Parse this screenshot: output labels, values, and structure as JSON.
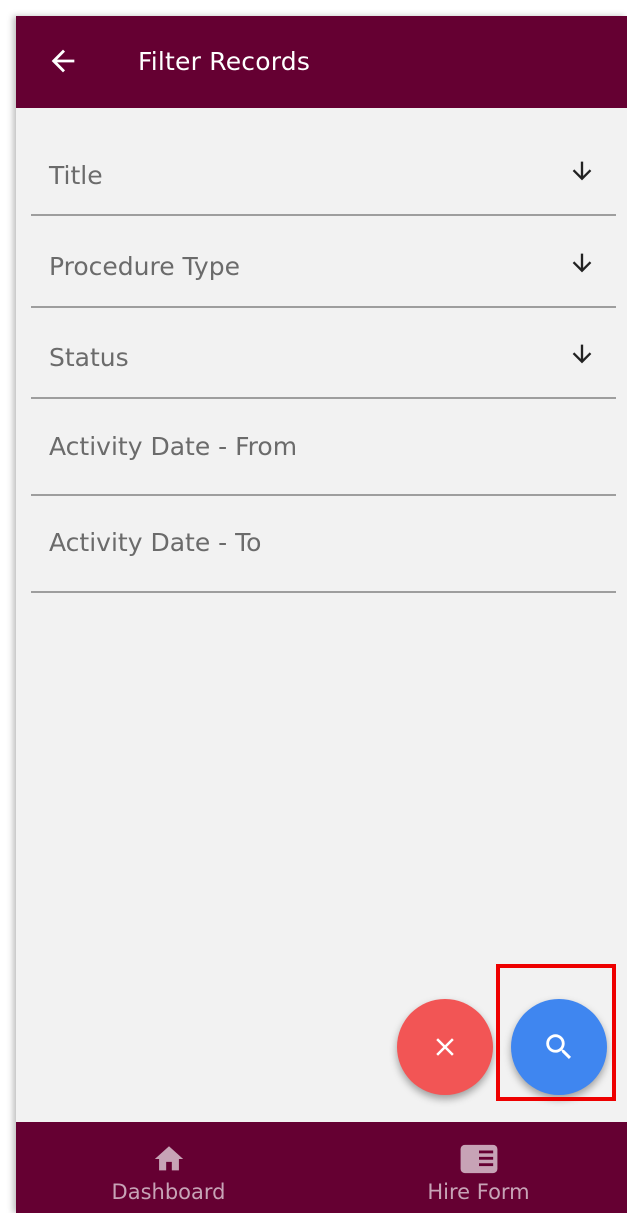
{
  "header": {
    "title": "Filter Records",
    "back_icon": "arrow-left-icon"
  },
  "filters": [
    {
      "label": "Title",
      "has_dropdown": true
    },
    {
      "label": "Procedure Type",
      "has_dropdown": true
    },
    {
      "label": "Status",
      "has_dropdown": true
    },
    {
      "label": "Activity Date - From",
      "has_dropdown": false
    },
    {
      "label": "Activity Date - To",
      "has_dropdown": false
    }
  ],
  "actions": {
    "clear_icon": "close-icon",
    "search_icon": "search-icon"
  },
  "bottom_nav": [
    {
      "label": "Dashboard",
      "icon": "home-icon"
    },
    {
      "label": "Hire Form",
      "icon": "form-icon"
    }
  ],
  "colors": {
    "primary": "#650032",
    "background": "#f2f2f2",
    "clear_fab": "#f25555",
    "search_fab": "#3f86f0",
    "highlight": "#ee0000"
  }
}
